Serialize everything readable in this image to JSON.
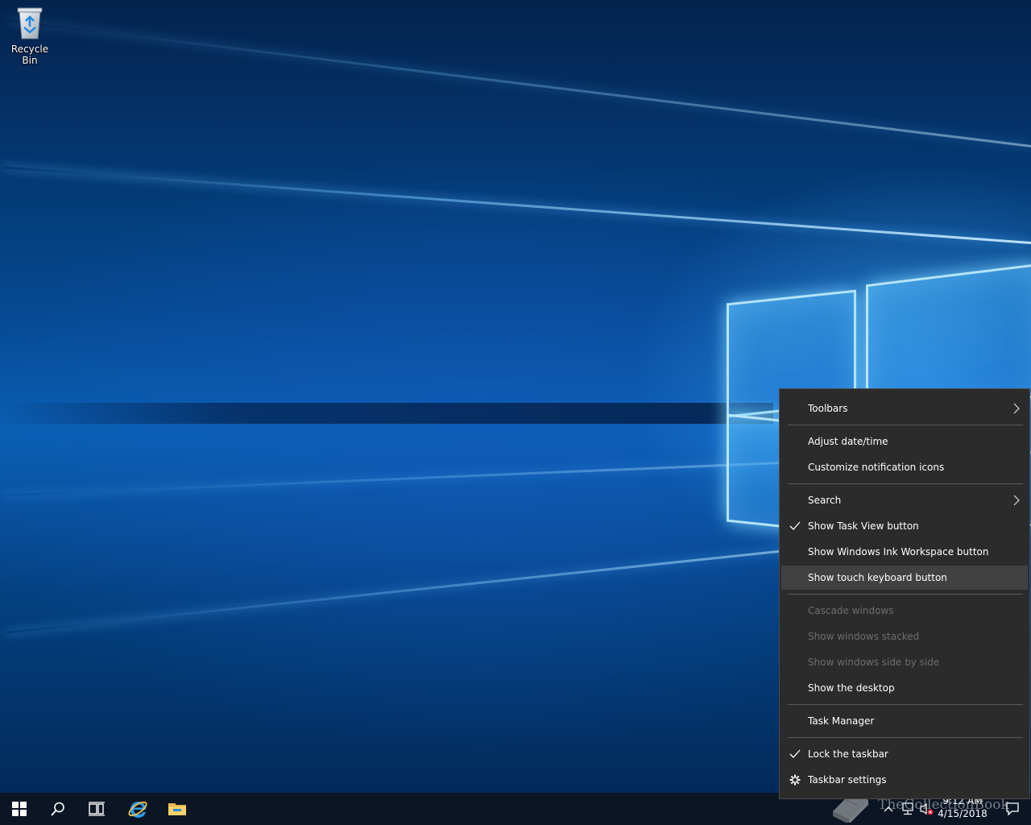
{
  "desktop": {
    "icons": [
      {
        "label": "Recycle Bin",
        "icon": "recycle-bin-icon"
      }
    ]
  },
  "context_menu": {
    "items": [
      {
        "label": "Toolbars",
        "submenu": true
      },
      {
        "label": "Adjust date/time"
      },
      {
        "label": "Customize notification icons"
      },
      {
        "label": "Search",
        "submenu": true
      },
      {
        "label": "Show Task View button",
        "checked": true
      },
      {
        "label": "Show Windows Ink Workspace button"
      },
      {
        "label": "Show touch keyboard button",
        "highlighted": true
      },
      {
        "label": "Cascade windows",
        "disabled": true
      },
      {
        "label": "Show windows stacked",
        "disabled": true
      },
      {
        "label": "Show windows side by side",
        "disabled": true
      },
      {
        "label": "Show the desktop"
      },
      {
        "label": "Task Manager"
      },
      {
        "label": "Lock the taskbar",
        "checked": true
      },
      {
        "label": "Taskbar settings",
        "icon": "gear-icon"
      }
    ]
  },
  "taskbar": {
    "buttons": [
      "start-icon",
      "search-icon",
      "task-view-icon",
      "internet-explorer-icon",
      "file-explorer-icon"
    ],
    "tray_icons": [
      "chevron-up-icon",
      "network-icon",
      "volume-muted-icon",
      "action-center-icon"
    ],
    "clock": {
      "time": "9:12 AM",
      "date": "4/15/2018"
    }
  },
  "watermark": {
    "text": "TheCollectionBook",
    "icon": "book-icon"
  },
  "colors": {
    "menu_bg": "#2b2b2b",
    "menu_hover": "#414141",
    "menu_disabled_text": "#6d6d6d",
    "taskbar_bg": "#0b1524"
  }
}
